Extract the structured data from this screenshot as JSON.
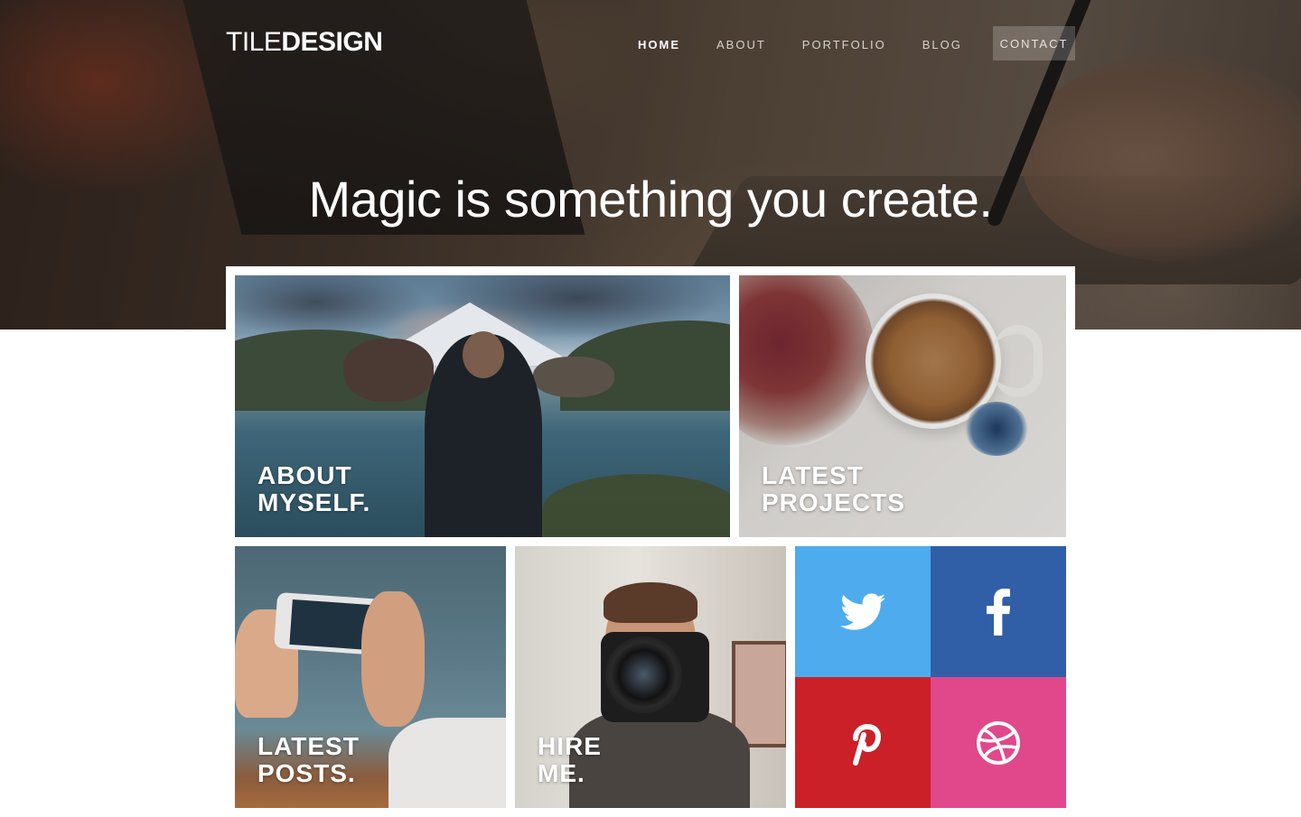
{
  "brand": {
    "logo_thin": "TILE",
    "logo_bold": "DESIGN"
  },
  "nav": {
    "items": [
      {
        "label": "HOME",
        "active": true
      },
      {
        "label": "ABOUT",
        "active": false
      },
      {
        "label": "PORTFOLIO",
        "active": false
      },
      {
        "label": "BLOG",
        "active": false
      }
    ],
    "contact_label": "CONTACT"
  },
  "hero": {
    "headline": "Magic is something you create."
  },
  "tiles": {
    "about": {
      "line1": "ABOUT",
      "line2": "MYSELF."
    },
    "projects": {
      "line1": "LATEST",
      "line2": "PROJECTS"
    },
    "posts": {
      "line1": "LATEST",
      "line2": "POSTS."
    },
    "hire": {
      "line1": "HIRE",
      "line2": "ME."
    }
  },
  "social": {
    "twitter": {
      "icon": "twitter-icon",
      "color": "#4eacee"
    },
    "facebook": {
      "icon": "facebook-icon",
      "color": "#305fa8"
    },
    "pinterest": {
      "icon": "pinterest-icon",
      "color": "#cb2027"
    },
    "dribbble": {
      "icon": "dribbble-icon",
      "color": "#e0488b"
    }
  }
}
